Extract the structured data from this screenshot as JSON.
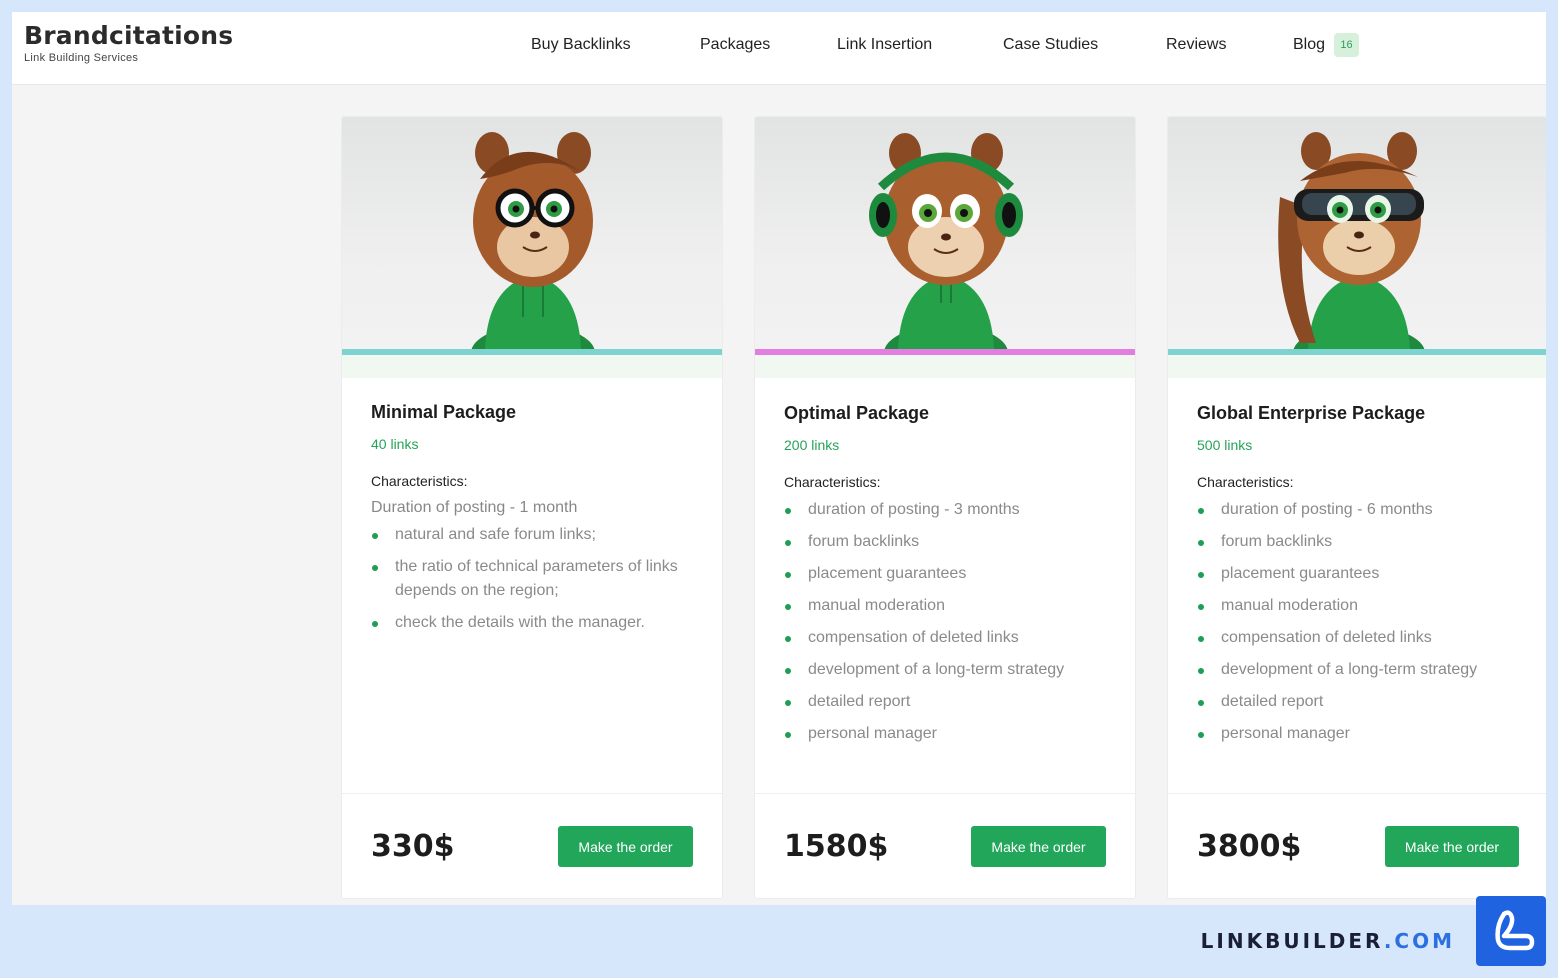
{
  "header": {
    "logo_title": "Brandcitations",
    "logo_subtitle": "Link Building Services",
    "nav": [
      {
        "label": "Buy Backlinks"
      },
      {
        "label": "Packages"
      },
      {
        "label": "Link Insertion"
      },
      {
        "label": "Case Studies"
      },
      {
        "label": "Reviews"
      },
      {
        "label": "Blog",
        "badge": "16"
      }
    ]
  },
  "packages": [
    {
      "title": "Minimal Package",
      "links": "40 links",
      "characteristics_label": "Characteristics:",
      "intro": "Duration of posting - 1 month",
      "features": [
        "natural and safe forum links;",
        "the ratio of technical parameters of links depends on the region;",
        "check the details with the manager."
      ],
      "price": "330$",
      "button": "Make the order",
      "stripe_color": "#7ed3d1"
    },
    {
      "title": "Optimal Package",
      "links": "200 links",
      "characteristics_label": "Characteristics:",
      "intro": "",
      "features": [
        "duration of posting - 3 months",
        "forum backlinks",
        "placement guarantees",
        "manual moderation",
        "compensation of deleted links",
        "development of a long-term strategy",
        "detailed report",
        "personal manager"
      ],
      "price": "1580$",
      "button": "Make the order",
      "stripe_color": "#e27ee0"
    },
    {
      "title": "Global Enterprise Package",
      "links": "500 links",
      "characteristics_label": "Characteristics:",
      "intro": "",
      "features": [
        "duration of posting - 6 months",
        "forum backlinks",
        "placement guarantees",
        "manual moderation",
        "compensation of deleted links",
        "development of a long-term strategy",
        "detailed report",
        "personal manager"
      ],
      "price": "3800$",
      "button": "Make the order",
      "stripe_color": "#7ed3d1"
    }
  ],
  "footer_brand": {
    "name": "LINKBUILDER",
    "tld": ".COM"
  },
  "colors": {
    "accent_green": "#22a65a",
    "brand_blue": "#1f63e0"
  }
}
